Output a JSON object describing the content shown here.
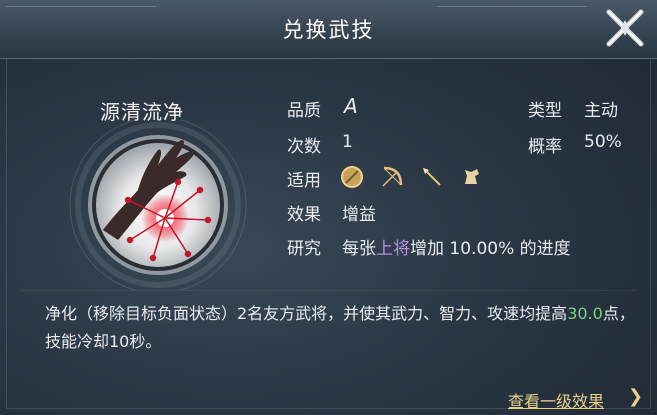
{
  "dialog": {
    "title": "兑换武技",
    "close_icon": "close-x-icon"
  },
  "skill": {
    "name": "源清流净",
    "emblem_icon": "purify-hand-icon"
  },
  "attributes": {
    "quality_label": "品质",
    "quality_value": "A",
    "count_label": "次数",
    "count_value": "1",
    "applies_label": "适用",
    "applies_icons": [
      "shield-icon",
      "bow-icon",
      "spear-icon",
      "horse-icon"
    ],
    "effect_label": "效果",
    "effect_value": "增益",
    "research_label": "研究",
    "research_prefix": "每张",
    "research_highlight": "上将",
    "research_suffix": "增加 10.00% 的进度",
    "type_label": "类型",
    "type_value": "主动",
    "rate_label": "概率",
    "rate_value": "50%"
  },
  "description": {
    "part1": "净化（移除目标负面状态）2名友方武将，并使其武力、智力、攻速均提高",
    "highlight": "30.0",
    "part2": "点，技能冷却10秒。"
  },
  "footer": {
    "link_label": "查看一级效果",
    "chevron": "❯"
  },
  "colors": {
    "accent_purple": "#b98fe6",
    "accent_green": "#79d57a",
    "link_gold": "#e9d089"
  }
}
